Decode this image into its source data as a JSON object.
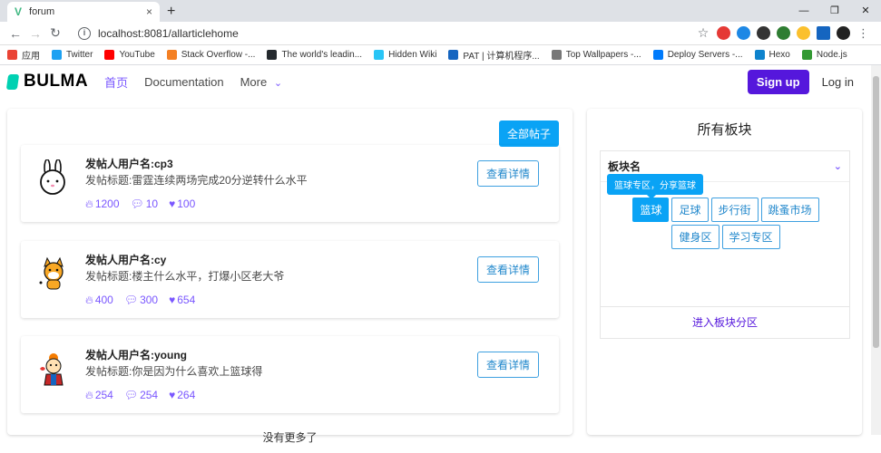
{
  "browser": {
    "tab_title": "forum",
    "tab_close": "×",
    "new_tab": "+",
    "controls": [
      "—",
      "❐",
      "✕"
    ],
    "url": "localhost:8081/allarticlehome",
    "bookmarks": [
      {
        "label": "应用",
        "color": "#ea4335",
        "icon": "apps-icon"
      },
      {
        "label": "Twitter",
        "color": "#1da1f2",
        "icon": "twitter-icon"
      },
      {
        "label": "YouTube",
        "color": "#ff0000",
        "icon": "youtube-icon"
      },
      {
        "label": "Stack Overflow -...",
        "color": "#f48024",
        "icon": "stackoverflow-icon"
      },
      {
        "label": "The world's leadin...",
        "color": "#24292e",
        "icon": "github-icon"
      },
      {
        "label": "Hidden Wiki",
        "color": "#29c5f6",
        "icon": "page-icon"
      },
      {
        "label": "PAT | 计算机程序...",
        "color": "#1565c0",
        "icon": "pat-icon"
      },
      {
        "label": "Top Wallpapers -...",
        "color": "#777777",
        "icon": "wallpaper-icon"
      },
      {
        "label": "Deploy Servers -...",
        "color": "#007bfc",
        "icon": "deploy-icon"
      },
      {
        "label": "Hexo",
        "color": "#0e83cd",
        "icon": "hexo-icon"
      },
      {
        "label": "Node.js",
        "color": "#339933",
        "icon": "nodejs-icon"
      }
    ]
  },
  "navbar": {
    "logo": "BULMA",
    "items": [
      {
        "label": "首页",
        "active": true
      },
      {
        "label": "Documentation",
        "active": false
      },
      {
        "label": "More",
        "active": false
      }
    ],
    "more_chevron": "⌄",
    "signup": "Sign up",
    "login": "Log in"
  },
  "main": {
    "all_posts_button": "全部帖子",
    "posts": [
      {
        "user": "发帖人用户名:cp3",
        "title": "发帖标题:雷霆连续两场完成20分逆转什么水平",
        "hot": "1200",
        "comments": "10",
        "likes": "100",
        "detail": "查看详情",
        "avatar": "rabbit-avatar"
      },
      {
        "user": "发帖人用户名:cy",
        "title": "发帖标题:楼主什么水平，打爆小区老大爷",
        "hot": "400",
        "comments": "300",
        "likes": "654",
        "detail": "查看详情",
        "avatar": "shiba-avatar"
      },
      {
        "user": "发帖人用户名:young",
        "title": "发帖标题:你是因为什么喜欢上篮球得",
        "hot": "254",
        "comments": "254",
        "likes": "264",
        "detail": "查看详情",
        "avatar": "kid-avatar"
      }
    ],
    "no_more": "没有更多了"
  },
  "sidebar": {
    "title": "所有板块",
    "board_label": "板块名",
    "tooltip": "篮球专区，分享篮球",
    "tags": [
      "篮球",
      "足球",
      "步行街",
      "跳蚤市场",
      "健身区",
      "学习专区"
    ],
    "enter_link": "进入板块分区"
  },
  "colors": {
    "accent": "#7a57ff",
    "primary": "#5517dc",
    "info": "#0aa3f5"
  }
}
